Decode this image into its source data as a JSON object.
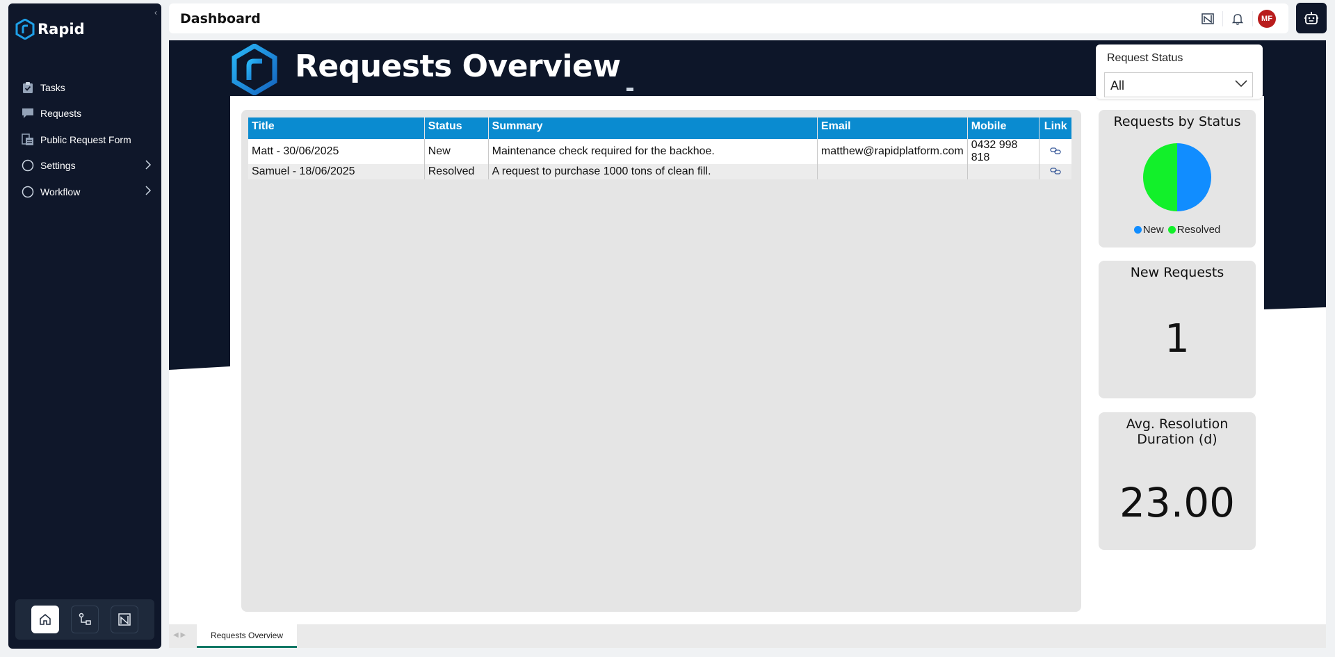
{
  "app": {
    "name": "Rapid"
  },
  "header": {
    "title": "Dashboard",
    "avatar_initials": "MF"
  },
  "sidebar": {
    "items": [
      {
        "label": "Tasks",
        "icon": "clipboard-check-icon"
      },
      {
        "label": "Requests",
        "icon": "chat-bubble-icon"
      },
      {
        "label": "Public Request Form",
        "icon": "form-icon"
      },
      {
        "label": "Settings",
        "icon": "circle-icon",
        "expandable": true
      },
      {
        "label": "Workflow",
        "icon": "circle-icon",
        "expandable": true
      }
    ],
    "bottom": [
      "home-icon",
      "workflow-icon",
      "report-icon"
    ]
  },
  "report": {
    "title": "Requests Overview",
    "filter": {
      "label": "Request Status",
      "value": "All"
    },
    "table": {
      "columns": [
        "Title",
        "Status",
        "Summary",
        "Email",
        "Mobile",
        "Link"
      ],
      "rows": [
        {
          "title": "Matt - 30/06/2025",
          "status": "New",
          "summary": "Maintenance check required for the backhoe.",
          "email": "matthew@rapidplatform.com",
          "mobile": "0432 998 818"
        },
        {
          "title": "Samuel - 18/06/2025",
          "status": "Resolved",
          "summary": "A request to purchase 1000 tons of clean fill.",
          "email": "",
          "mobile": ""
        }
      ]
    },
    "status_card": {
      "title": "Requests by Status"
    },
    "new_requests": {
      "title": "New Requests",
      "value": "1"
    },
    "avg_resolution": {
      "title_line1": "Avg. Resolution",
      "title_line2": "Duration (d)",
      "value": "23.00"
    }
  },
  "chart_data": {
    "type": "pie",
    "title": "Requests by Status",
    "categories": [
      "New",
      "Resolved"
    ],
    "values": [
      1,
      1
    ],
    "colors": [
      "#118dff",
      "#12f02a"
    ],
    "legend": "bottom"
  },
  "tabs": [
    {
      "label": "Requests Overview",
      "active": true
    }
  ],
  "colors": {
    "navy": "#0f172a",
    "table_header": "#0a8bd0",
    "accent_tab": "#117865"
  }
}
